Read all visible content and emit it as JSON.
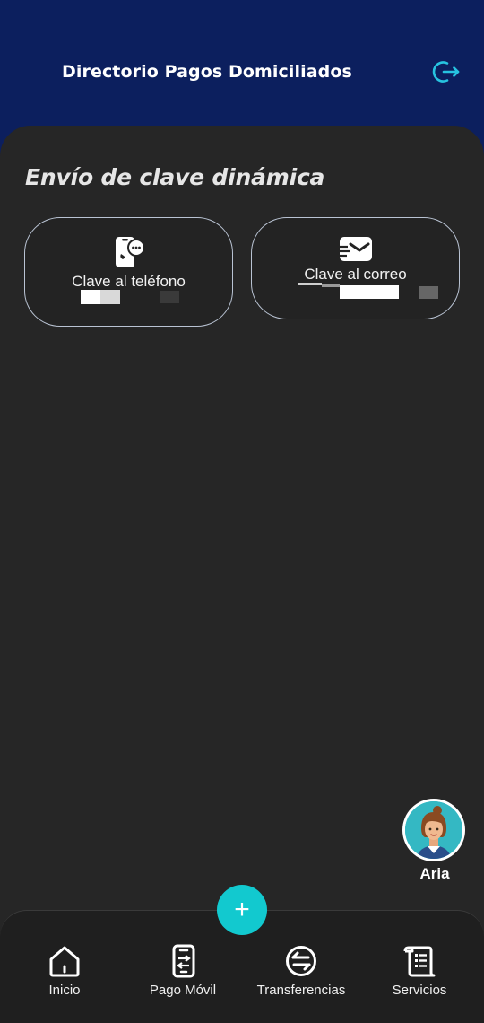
{
  "header": {
    "title": "Directorio Pagos Domiciliados",
    "logout_icon": "logout-icon"
  },
  "section": {
    "title": "Envío de clave dinámica"
  },
  "options": [
    {
      "label": "Clave al teléfono",
      "icon": "phone-message-icon"
    },
    {
      "label": "Clave al correo",
      "icon": "envelope-fast-icon"
    }
  ],
  "assistant": {
    "name": "Aria"
  },
  "fab": {
    "symbol": "+"
  },
  "bottom_nav": [
    {
      "label": "Inicio",
      "icon": "home-icon"
    },
    {
      "label": "Pago Móvil",
      "icon": "mobile-transfer-icon"
    },
    {
      "label": "Transferencias",
      "icon": "transfer-icon"
    },
    {
      "label": "Servicios",
      "icon": "services-icon"
    }
  ],
  "colors": {
    "header_bg": "#0c1f5e",
    "background": "#262626",
    "accent": "#12c9cf",
    "card_border": "#b9c3d3"
  }
}
